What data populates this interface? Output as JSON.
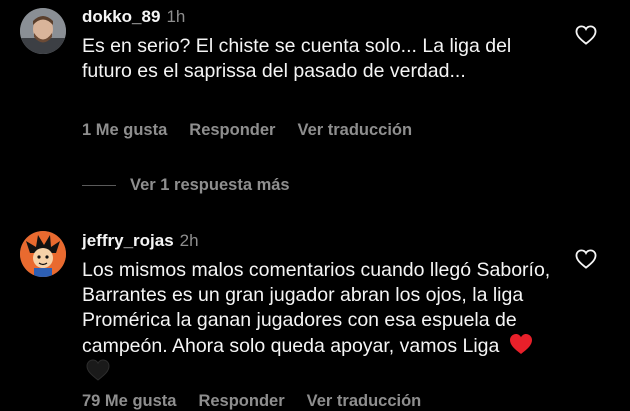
{
  "comments": [
    {
      "username": "dokko_89",
      "time": "1h",
      "text": "Es en serio? El chiste se cuenta solo... La liga del futuro es el saprissa del pasado de verdad...",
      "likes": "1 Me gusta",
      "reply": "Responder",
      "translate": "Ver traducción"
    },
    {
      "username": "jeffry_rojas",
      "time": "2h",
      "text": "Los mismos malos comentarios cuando llegó Saborío, Barrantes es un gran jugador abran los ojos, la liga Promérica la ganan jugadores con esa espuela de campeón. Ahora solo queda apoyar, vamos Liga",
      "likes": "79 Me gusta",
      "reply": "Responder",
      "translate": "Ver traducción"
    }
  ],
  "view_replies": "Ver 1 respuesta más",
  "icons": {
    "like": "heart-outline-icon",
    "emoji_red": "red-heart-emoji",
    "emoji_black": "black-heart-emoji"
  },
  "colors": {
    "background": "#000000",
    "text": "#f5f5f5",
    "muted": "#8e8e8e",
    "red_heart": "#e8202a"
  }
}
